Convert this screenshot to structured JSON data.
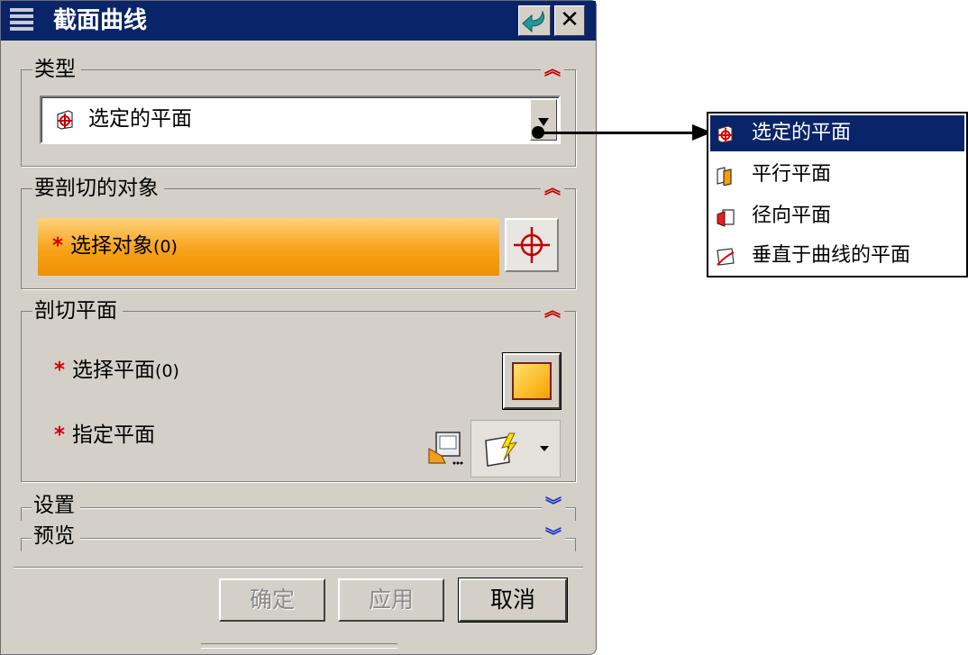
{
  "dialog": {
    "title": "截面曲线"
  },
  "groups": {
    "type": {
      "label": "类型",
      "selected_value": "选定的平面"
    },
    "objects": {
      "label": "要剖切的对象",
      "select_label": "选择对象",
      "select_count": "(0)"
    },
    "cut_plane": {
      "label": "剖切平面",
      "select_plane_label": "选择平面",
      "select_plane_count": "(0)",
      "specify_plane_label": "指定平面"
    },
    "settings": {
      "label": "设置"
    },
    "preview": {
      "label": "预览"
    }
  },
  "buttons": {
    "ok": "确定",
    "apply": "应用",
    "cancel": "取消"
  },
  "type_dropdown": {
    "options": [
      "选定的平面",
      "平行平面",
      "径向平面",
      "垂直于曲线的平面"
    ],
    "selected_index": 0
  },
  "colors": {
    "title_bar": "#0a246a",
    "dialog_bg": "#d4d0c8",
    "required_star": "#d00000",
    "select_bar": "#f7a21a"
  }
}
